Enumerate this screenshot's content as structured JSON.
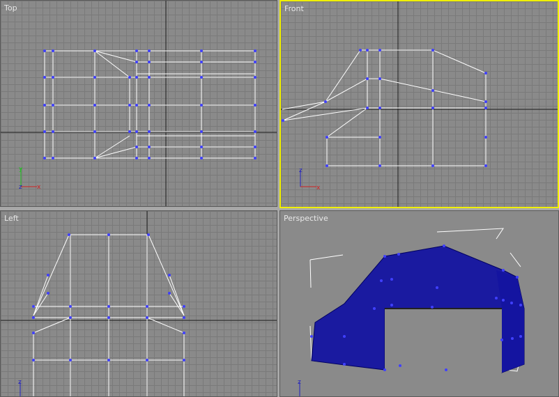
{
  "viewports": {
    "top": {
      "label": "Top"
    },
    "front": {
      "label": "Front"
    },
    "left": {
      "label": "Left"
    },
    "perspective": {
      "label": "Perspective"
    }
  },
  "axes": {
    "y": "y",
    "z": "z",
    "x": "x"
  },
  "colors": {
    "viewport_bg": "#8a8a8a",
    "grid_line": "#7a7a7a",
    "axis_line": "#1a1a1a",
    "wire": "#ffffff",
    "vertex": "#4040ff",
    "active_border": "#f0f000",
    "shaded_mesh": "#1a1aa0",
    "label_text": "#e8e8e8"
  }
}
